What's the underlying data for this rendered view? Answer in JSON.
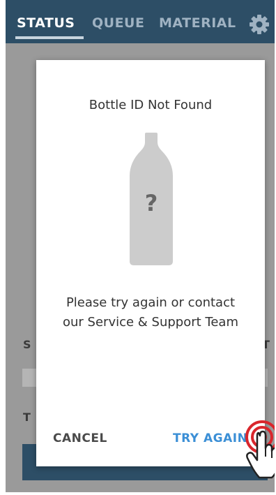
{
  "nav": {
    "tabs": [
      {
        "label": "STATUS",
        "active": true
      },
      {
        "label": "QUEUE",
        "active": false
      },
      {
        "label": "MATERIAL",
        "active": false
      }
    ],
    "settings_icon": "gear-icon"
  },
  "dialog": {
    "title": "Bottle ID Not Found",
    "illustration_icon": "bottle-unknown-icon",
    "illustration_glyph": "?",
    "message_line1": "Please try again or contact",
    "message_line2": "our Service & Support Team",
    "cancel_label": "CANCEL",
    "try_again_label": "TRY AGAIN"
  },
  "colors": {
    "header": "#2d4e66",
    "accent": "#3b8fd6",
    "overlay": "#9a9a9a",
    "indicator": "#d9262c"
  }
}
